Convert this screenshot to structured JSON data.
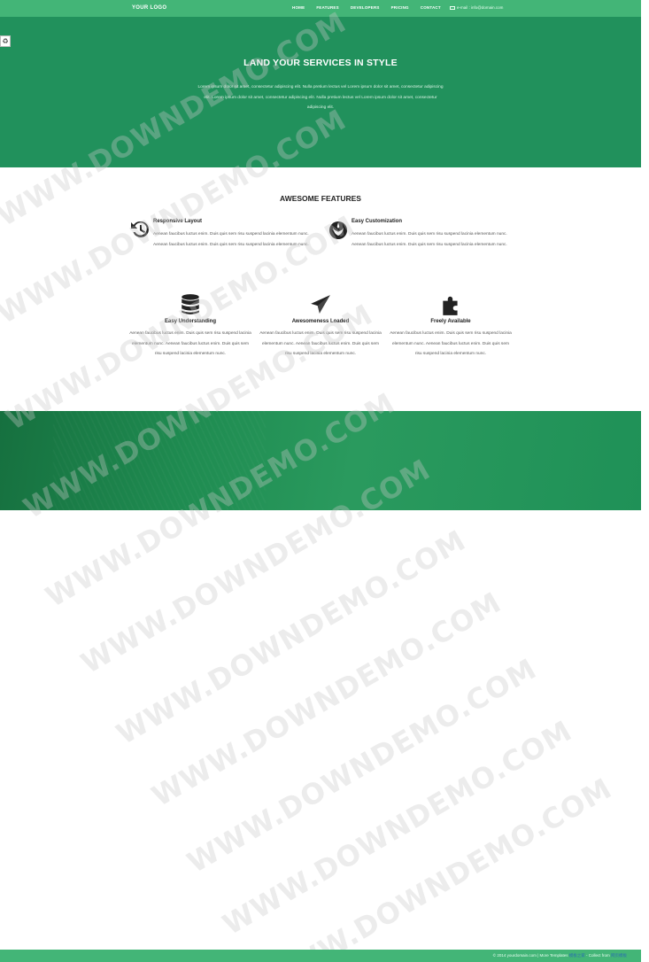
{
  "nav": {
    "logo": "YOUR LOGO",
    "links": [
      "HOME",
      "FEATURES",
      "DEVELOPERS",
      "PRICING",
      "CONTACT"
    ],
    "email": "e-mail : info@domain.com"
  },
  "side_button_glyph": "♻",
  "hero": {
    "title": "LAND YOUR SERVICES IN STYLE",
    "text": "Lorem ipsum dolor sit amet, consectetur adipiscing elit. Nulla pretium lectus vel Lorem ipsum dolor sit amet, consectetur adipiscing elit. Lorem ipsum dolor sit amet, consectetur adipiscing elit. Nulla pretium lectus vel Lorem ipsum dolor sit amet, consectetur adipiscing elit."
  },
  "features": {
    "title": "AWESOME FEATURES",
    "top": [
      {
        "icon": "history-icon",
        "title": "Responsive Layout",
        "desc": "Aenean faucibus luctus enim. Duis quis sem risu suspend lacinia elementum nunc. Aenean faucibus luctus enim. Duis quis sem risu suspend lacinia elementum nunc."
      },
      {
        "icon": "rebel-icon",
        "title": "Easy Customization",
        "desc": "Aenean faucibus luctus enim. Duis quis sem risu suspend lacinia elementum nunc. Aenean faucibus luctus enim. Duis quis sem risu suspend lacinia elementum nunc."
      }
    ],
    "bottom": [
      {
        "icon": "database-icon",
        "title": "Easy Understanding",
        "desc": "Aenean faucibus luctus enim. Duis quis sem risu suspend lacinia elementum nunc. Aenean faucibus luctus enim. Duis quis sem risu suspend lacinia elementum nunc."
      },
      {
        "icon": "paper-plane-icon",
        "title": "Awesomeness Loaded",
        "desc": "Aenean faucibus luctus enim. Duis quis sem risu suspend lacinia elementum nunc. Aenean faucibus luctus enim. Duis quis sem risu suspend lacinia elementum nunc."
      },
      {
        "icon": "puzzle-icon",
        "title": "Freely Available",
        "desc": "Aenean faucibus luctus enim. Duis quis sem risu suspend lacinia elementum nunc. Aenean faucibus luctus enim. Duis quis sem risu suspend lacinia elementum nunc."
      }
    ]
  },
  "watermark": "WWW.DOWNDEMO.COM",
  "footer": {
    "prefix": "© 2014 yourdomain.com | More Templates ",
    "link1": "模板之家",
    "middle": " - Collect from ",
    "link2": "网页模板"
  },
  "colors": {
    "nav": "#43b577",
    "hero": "#21915c",
    "footer": "#43b577",
    "icon": "#222222"
  }
}
